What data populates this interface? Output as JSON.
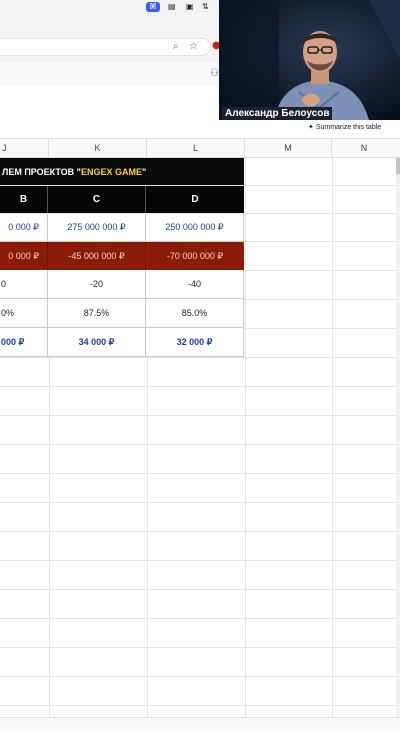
{
  "sysbar": {
    "icons": [
      "wifi-icon",
      "status-icon",
      "lock-icon",
      "arrows-icon"
    ]
  },
  "browser": {
    "icons": [
      "zoom-icon",
      "bookmark-star-icon",
      "extension-icon"
    ]
  },
  "webcam": {
    "name": "Александр Белоусов"
  },
  "sheet": {
    "summarize_label": "Summarize this table",
    "columns": [
      "J",
      "K",
      "L",
      "M",
      "N"
    ],
    "banner": {
      "text_before": "ЛЕМ ПРОЕКТОВ \"",
      "highlight": "ENGEX GAME",
      "text_after": "\""
    },
    "table": {
      "headers": [
        "B",
        "C",
        "D"
      ],
      "rows": [
        [
          "0 000 ₽",
          "275 000 000 ₽",
          "250 000 000 ₽"
        ],
        [
          "0 000 ₽",
          "-45 000 000 ₽",
          "-70 000 000 ₽"
        ],
        [
          "0",
          "-20",
          "-40"
        ],
        [
          "0%",
          "87.5%",
          "85.0%"
        ],
        [
          "000 ₽",
          "34 000 ₽",
          "32 000 ₽"
        ]
      ]
    },
    "colors": {
      "header_bg": "#050505",
      "loss_row_bg": "#8c1b06",
      "value_text": "#1d3f9a",
      "highlight_text": "#ffd23c"
    }
  }
}
